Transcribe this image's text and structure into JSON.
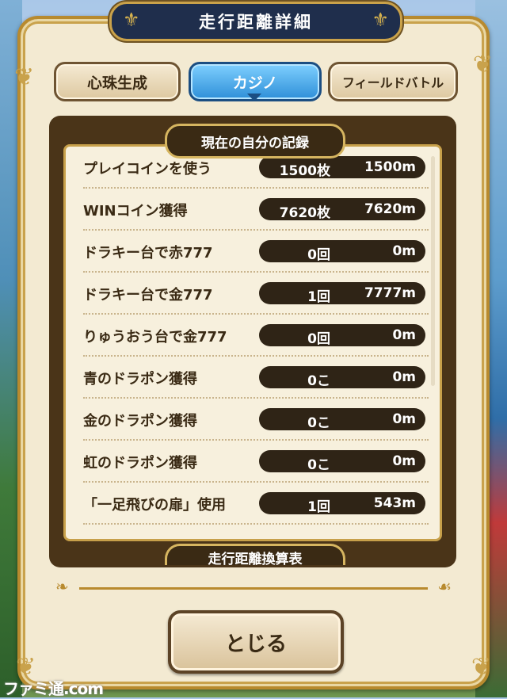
{
  "title": "走行距離詳細",
  "tabs": [
    {
      "label": "心珠生成"
    },
    {
      "label": "カジノ"
    },
    {
      "label": "フィールドバトル"
    }
  ],
  "section": {
    "title": "現在の自分の記録"
  },
  "records": [
    {
      "label": "プレイコインを使う",
      "count": "1500枚",
      "distance": "1500m"
    },
    {
      "label": "WINコイン獲得",
      "count": "7620枚",
      "distance": "7620m"
    },
    {
      "label": "ドラキー台で赤777",
      "count": "0回",
      "distance": "0m"
    },
    {
      "label": "ドラキー台で金777",
      "count": "1回",
      "distance": "7777m"
    },
    {
      "label": "りゅうおう台で金777",
      "count": "0回",
      "distance": "0m"
    },
    {
      "label": "青のドラポン獲得",
      "count": "0こ",
      "distance": "0m"
    },
    {
      "label": "金のドラポン獲得",
      "count": "0こ",
      "distance": "0m"
    },
    {
      "label": "虹のドラポン獲得",
      "count": "0こ",
      "distance": "0m"
    },
    {
      "label": "「一足飛びの扉」使用",
      "count": "1回",
      "distance": "543m"
    }
  ],
  "next_section": {
    "title": "走行距離換算表"
  },
  "close_label": "とじる",
  "watermark": "ファミ通.com"
}
